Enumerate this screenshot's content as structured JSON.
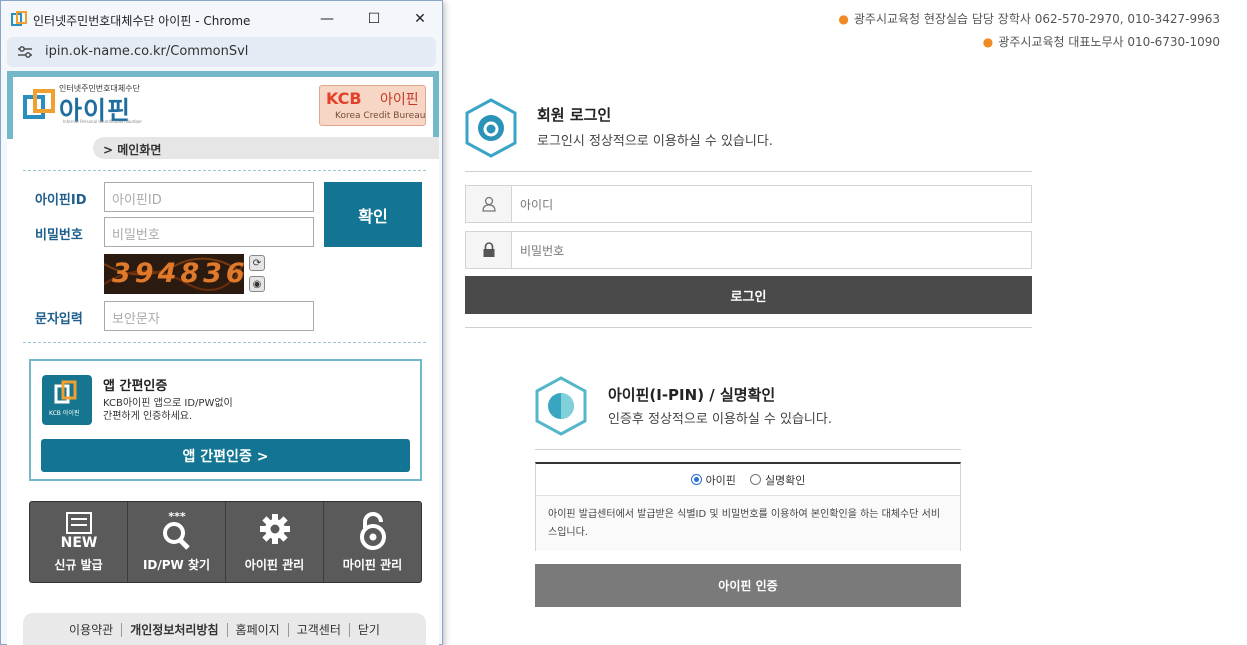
{
  "contacts": [
    "광주시교육청 현장실습 담당 장학사 062-570-2970, 010-3427-9963",
    "광주시교육청 대표노무사 010-6730-1090"
  ],
  "member_login": {
    "title": "회원 로그인",
    "subtitle": "로그인시 정상적으로 이용하실 수 있습니다.",
    "id_placeholder": "아이디",
    "pw_placeholder": "비밀번호",
    "login_button": "로그인",
    "icon": "lock-open-icon"
  },
  "ipin_section": {
    "title": "아이핀(I-PIN) / 실명확인",
    "subtitle": "인증후 정상적으로 이용하실 수 있습니다.",
    "radio_ipin": "아이핀",
    "radio_realname": "실명확인",
    "selected": "아이핀",
    "description": "아이핀 발급센터에서 발급받은 식별ID 및 비밀번호를 이용하여 본인확인을 하는 대체수단 서비스입니다.",
    "button": "아이핀 인증"
  },
  "popup": {
    "window_title": "인터넷주민번호대체수단 아이핀 - Chrome",
    "url": "ipin.ok-name.co.kr/CommonSvl",
    "logo_small": "인터넷주민번호대체수단",
    "logo_big": "아이핀",
    "logo_tiny": "Internet Personal Identification Number",
    "kcb_brand": "KCB",
    "kcb_ipin": "아이핀",
    "kcb_sub": "Korea Credit Bureau",
    "breadcrumb": "> 메인화면",
    "id_label": "아이핀ID",
    "id_placeholder": "아이핀ID",
    "pw_label": "비밀번호",
    "pw_placeholder": "비밀번호",
    "captcha_text": "394836",
    "captcha_label": "문자입력",
    "captcha_placeholder": "보안문자",
    "confirm_button": "확인",
    "app_auth": {
      "title": "앱 간편인증",
      "desc_line1": "KCB아이핀 앱으로 ID/PW없이",
      "desc_line2": "간편하게 인증하세요.",
      "icon_caption": "KCB 아이핀",
      "button": "앱 간편인증 >"
    },
    "menu": [
      {
        "label": "신규 발급",
        "icon": "new-icon"
      },
      {
        "label": "ID/PW 찾기",
        "icon": "search-icon"
      },
      {
        "label": "아이핀 관리",
        "icon": "gear-icon"
      },
      {
        "label": "마이핀 관리",
        "icon": "lock-icon"
      }
    ],
    "new_badge": "NEW",
    "stars": "***",
    "footer": [
      "이용약관",
      "개인정보처리방침",
      "홈페이지",
      "고객센터",
      "닫기"
    ]
  },
  "colors": {
    "accent": "#137593",
    "frame": "#72b8c8",
    "orange": "#f08a24",
    "dark_button": "#4a4a4a",
    "gray_button": "#7a7a7a"
  }
}
